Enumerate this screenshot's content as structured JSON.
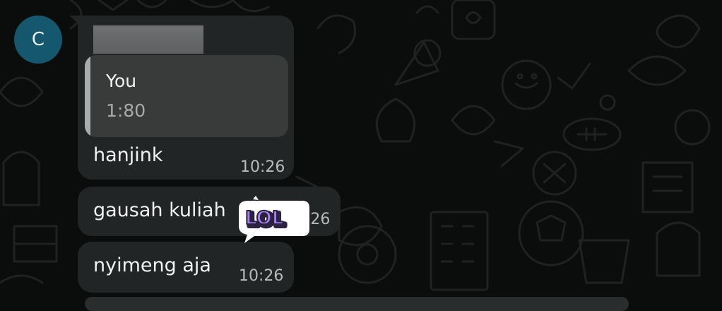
{
  "chat": {
    "avatar_initial": "C",
    "messages": [
      {
        "quote": {
          "author": "You",
          "text": "1:80"
        },
        "text": "hanjink",
        "time": "10:26"
      },
      {
        "text": "gausah kuliah",
        "time": "10:26",
        "reaction_sticker": "LOL"
      },
      {
        "text": "nyimeng aja",
        "time": "10:26"
      }
    ]
  },
  "colors": {
    "background": "#0b0c0c",
    "bubble": "#222525",
    "quote_box": "#393b3b",
    "avatar": "#15576d",
    "sticker_purple": "#9b6be6"
  },
  "icons": [
    "chat-wallpaper-doodles",
    "lol-sticker"
  ]
}
